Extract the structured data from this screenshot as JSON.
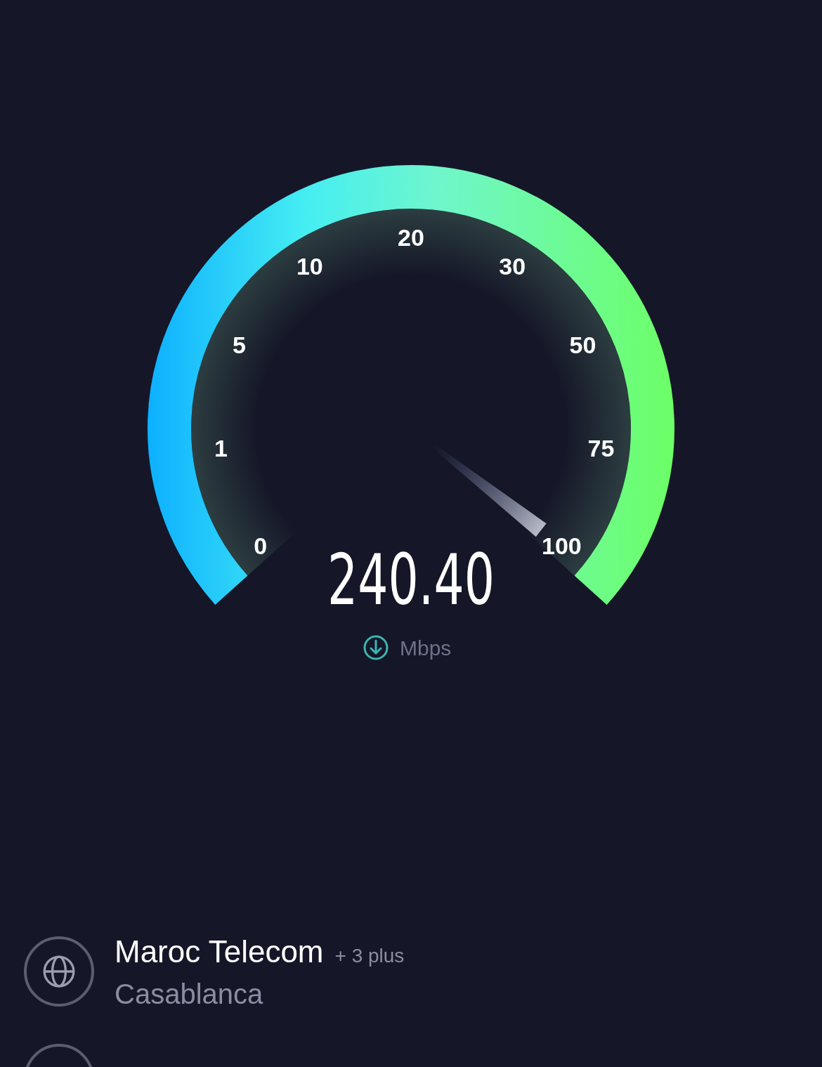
{
  "gauge": {
    "scale_labels": [
      "0",
      "1",
      "5",
      "10",
      "20",
      "30",
      "50",
      "75",
      "100"
    ],
    "speed": "240.40",
    "unit": "Mbps"
  },
  "servers": [
    {
      "kind": "provider",
      "name": "Maroc Telecom",
      "extra": "+ 3 plus",
      "location": "Casablanca"
    }
  ]
}
